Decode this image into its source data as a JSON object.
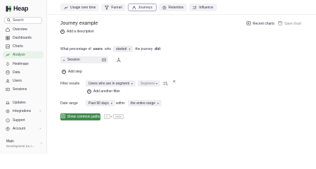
{
  "app": {
    "logo_text": "Heap"
  },
  "sidebar": {
    "search_label": "Search",
    "items": [
      {
        "label": "Overview",
        "icon": "home-icon"
      },
      {
        "label": "Dashboards",
        "icon": "dashboard-icon"
      },
      {
        "label": "Charts",
        "icon": "charts-icon"
      },
      {
        "label": "Analyze",
        "icon": "analyze-icon",
        "active": true
      },
      {
        "label": "Heatmaps",
        "icon": "heatmap-icon"
      },
      {
        "label": "Data",
        "icon": "data-icon"
      },
      {
        "label": "Users",
        "icon": "users-icon"
      },
      {
        "label": "Sessions",
        "icon": "sessions-icon"
      },
      {
        "label": "Updates",
        "icon": "updates-icon"
      },
      {
        "label": "Integrations",
        "icon": "integrations-icon",
        "caret": true
      },
      {
        "label": "Support",
        "icon": "support-icon"
      },
      {
        "label": "Account",
        "icon": "account-icon",
        "caret": true
      }
    ],
    "env_name": "Main",
    "env_sub": "Development (re.c..."
  },
  "tabs": [
    {
      "label": "Usage over time",
      "icon": "usage-icon"
    },
    {
      "label": "Funnel",
      "icon": "funnel-icon"
    },
    {
      "label": "Journeys",
      "icon": "journeys-icon",
      "active": true
    },
    {
      "label": "Retention",
      "icon": "retention-icon"
    },
    {
      "label": "Influence",
      "icon": "influence-icon"
    }
  ],
  "header": {
    "title": "Journey example",
    "add_description": "Add a description",
    "recent_charts": "Recent charts",
    "save_chart": "Save chart"
  },
  "query": {
    "prefix": "What percentage of",
    "subject": "users",
    "who": "who",
    "action": "started",
    "suffix": "the journey",
    "suffix2": "did:",
    "step_value": "Session",
    "add_step": "Add step",
    "filter_label": "Filter results",
    "filter_value": "Users who are in segment",
    "segment_placeholder": "Segment",
    "add_filter": "Add another filter",
    "date_label": "Date range",
    "date_value": "Past 90 days",
    "within": "within",
    "range_value": "the entire range",
    "show_paths": "Show common paths",
    "pager_num": "4",
    "pager_text": "Hide"
  },
  "colors": {
    "accent": "#3f8a4c",
    "active_bg": "#e8f3e9"
  }
}
